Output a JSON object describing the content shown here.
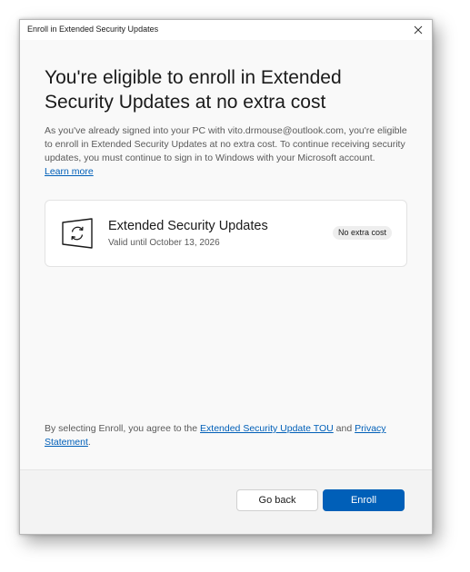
{
  "window": {
    "title": "Enroll in Extended Security Updates",
    "close_icon": "close-icon"
  },
  "main": {
    "heading": "You're eligible to enroll in Extended Security Updates at no extra cost",
    "description": "As you've already signed into your PC with vito.drmouse@outlook.com, you're eligible to enroll in Extended Security Updates at no extra cost. To continue receiving security updates, you must continue to sign in to Windows with your Microsoft account.",
    "learn_more": "Learn more"
  },
  "card": {
    "icon": "windows-update-icon",
    "title": "Extended Security Updates",
    "subtitle": "Valid until October 13, 2026",
    "badge": "No extra cost"
  },
  "terms": {
    "prefix": "By selecting Enroll, you agree to the",
    "tou_link": "Extended Security Update TOU",
    "and": "and",
    "privacy_link": "Privacy Statement",
    "suffix": "."
  },
  "footer": {
    "back_label": "Go back",
    "enroll_label": "Enroll"
  },
  "colors": {
    "accent": "#005fb8",
    "window_bg": "#f9f9f9",
    "footer_bg": "#f3f3f3"
  }
}
